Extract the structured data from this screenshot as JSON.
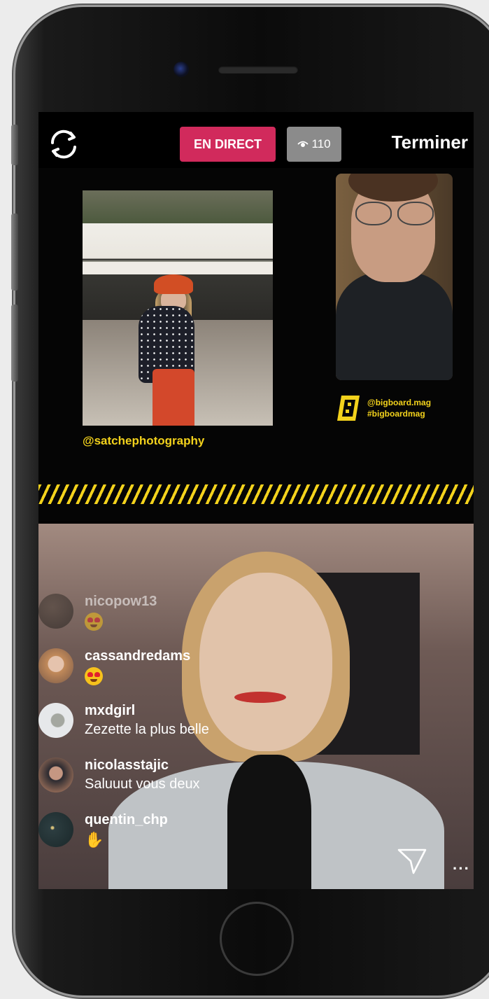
{
  "top_bar": {
    "live_label": "EN DIRECT",
    "viewer_count": "110",
    "end_label": "Terminer"
  },
  "board": {
    "photo1_handle": "@satchephotography",
    "photo2_handle_line1": "@bigboard.mag",
    "photo2_handle_line2": "#bigboardmag"
  },
  "comments": [
    {
      "user": "nicopow13",
      "text": "",
      "emoji": "heart-eyes"
    },
    {
      "user": "cassandredams",
      "text": "",
      "emoji": "heart-eyes"
    },
    {
      "user": "mxdgirl",
      "text": "Zezette la plus belle",
      "emoji": ""
    },
    {
      "user": "nicolasstajic",
      "text": "Saluuut vous deux",
      "emoji": ""
    },
    {
      "user": "quentin_chp",
      "text": "",
      "emoji": "waving-hand"
    }
  ],
  "colors": {
    "live_badge": "#d12a5c",
    "accent_yellow": "#f3d21c",
    "viewer_badge": "#8b8b8b"
  }
}
